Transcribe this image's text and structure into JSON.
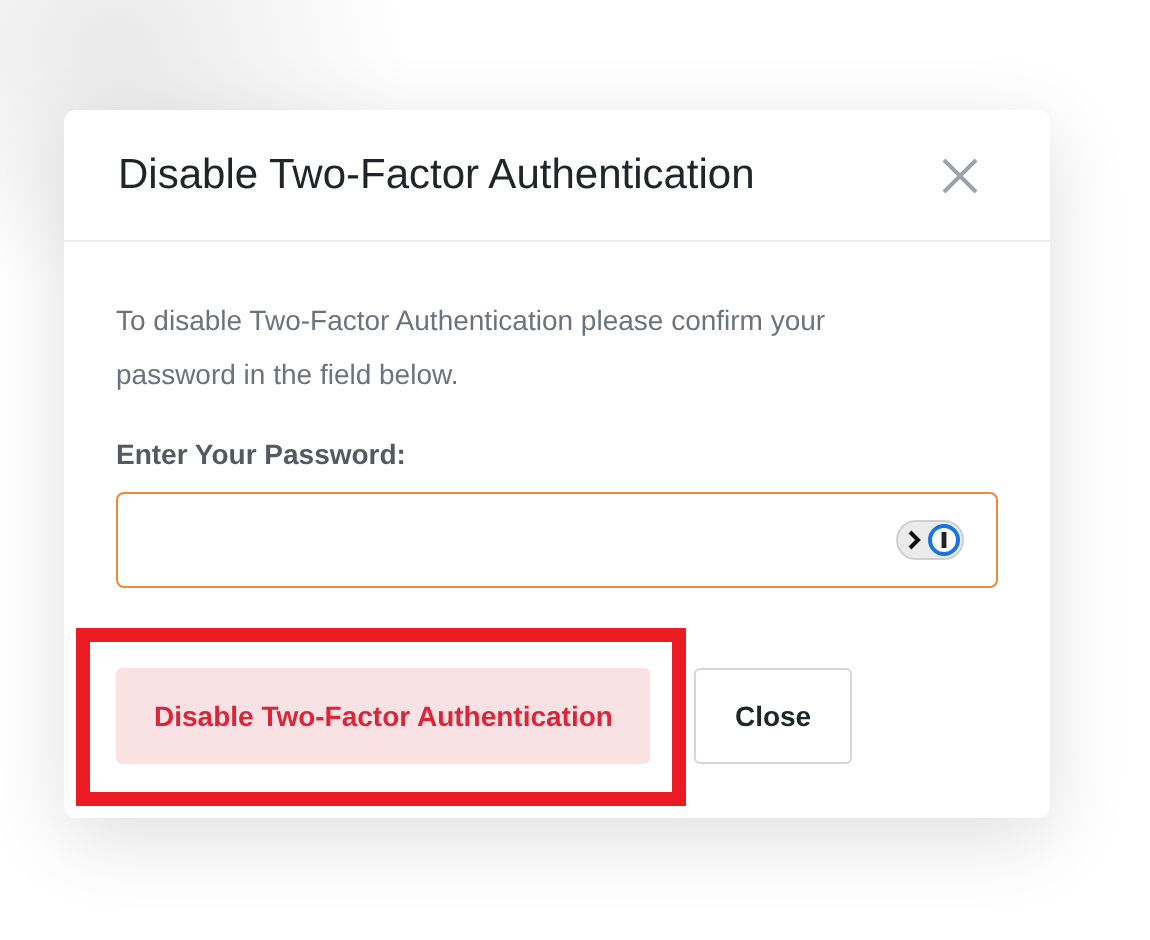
{
  "dialog": {
    "title": "Disable Two-Factor Authentication",
    "message": "To disable Two-Factor Authentication please confirm your password in the field below.",
    "field": {
      "label": "Enter Your Password:",
      "focused": true
    },
    "buttons": [
      {
        "label": "Disable Two-Factor Authentication",
        "kind": "danger",
        "highlighted": true
      },
      {
        "label": "Close",
        "kind": "plain"
      }
    ]
  }
}
